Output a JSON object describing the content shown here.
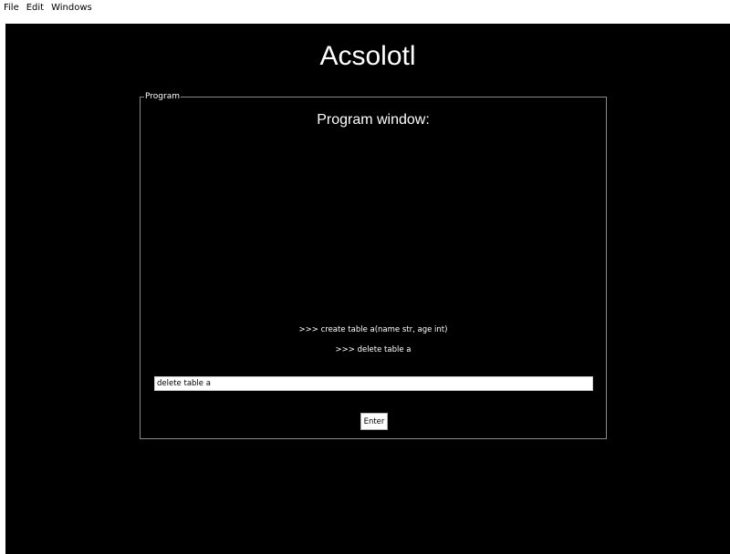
{
  "menubar": {
    "items": [
      {
        "label": "File"
      },
      {
        "label": "Edit"
      },
      {
        "label": "Windows"
      }
    ]
  },
  "app": {
    "title": "Acsolotl"
  },
  "program": {
    "group_label": "Program",
    "heading": "Program window:",
    "history": [
      ">>> create table a(name str, age int)",
      ">>> delete table a"
    ],
    "input_value": "delete table a",
    "enter_label": "Enter"
  },
  "colors": {
    "background": "#000000",
    "text": "#ffffff",
    "group_border": "#8a8a8a",
    "input_background": "#ffffff"
  }
}
